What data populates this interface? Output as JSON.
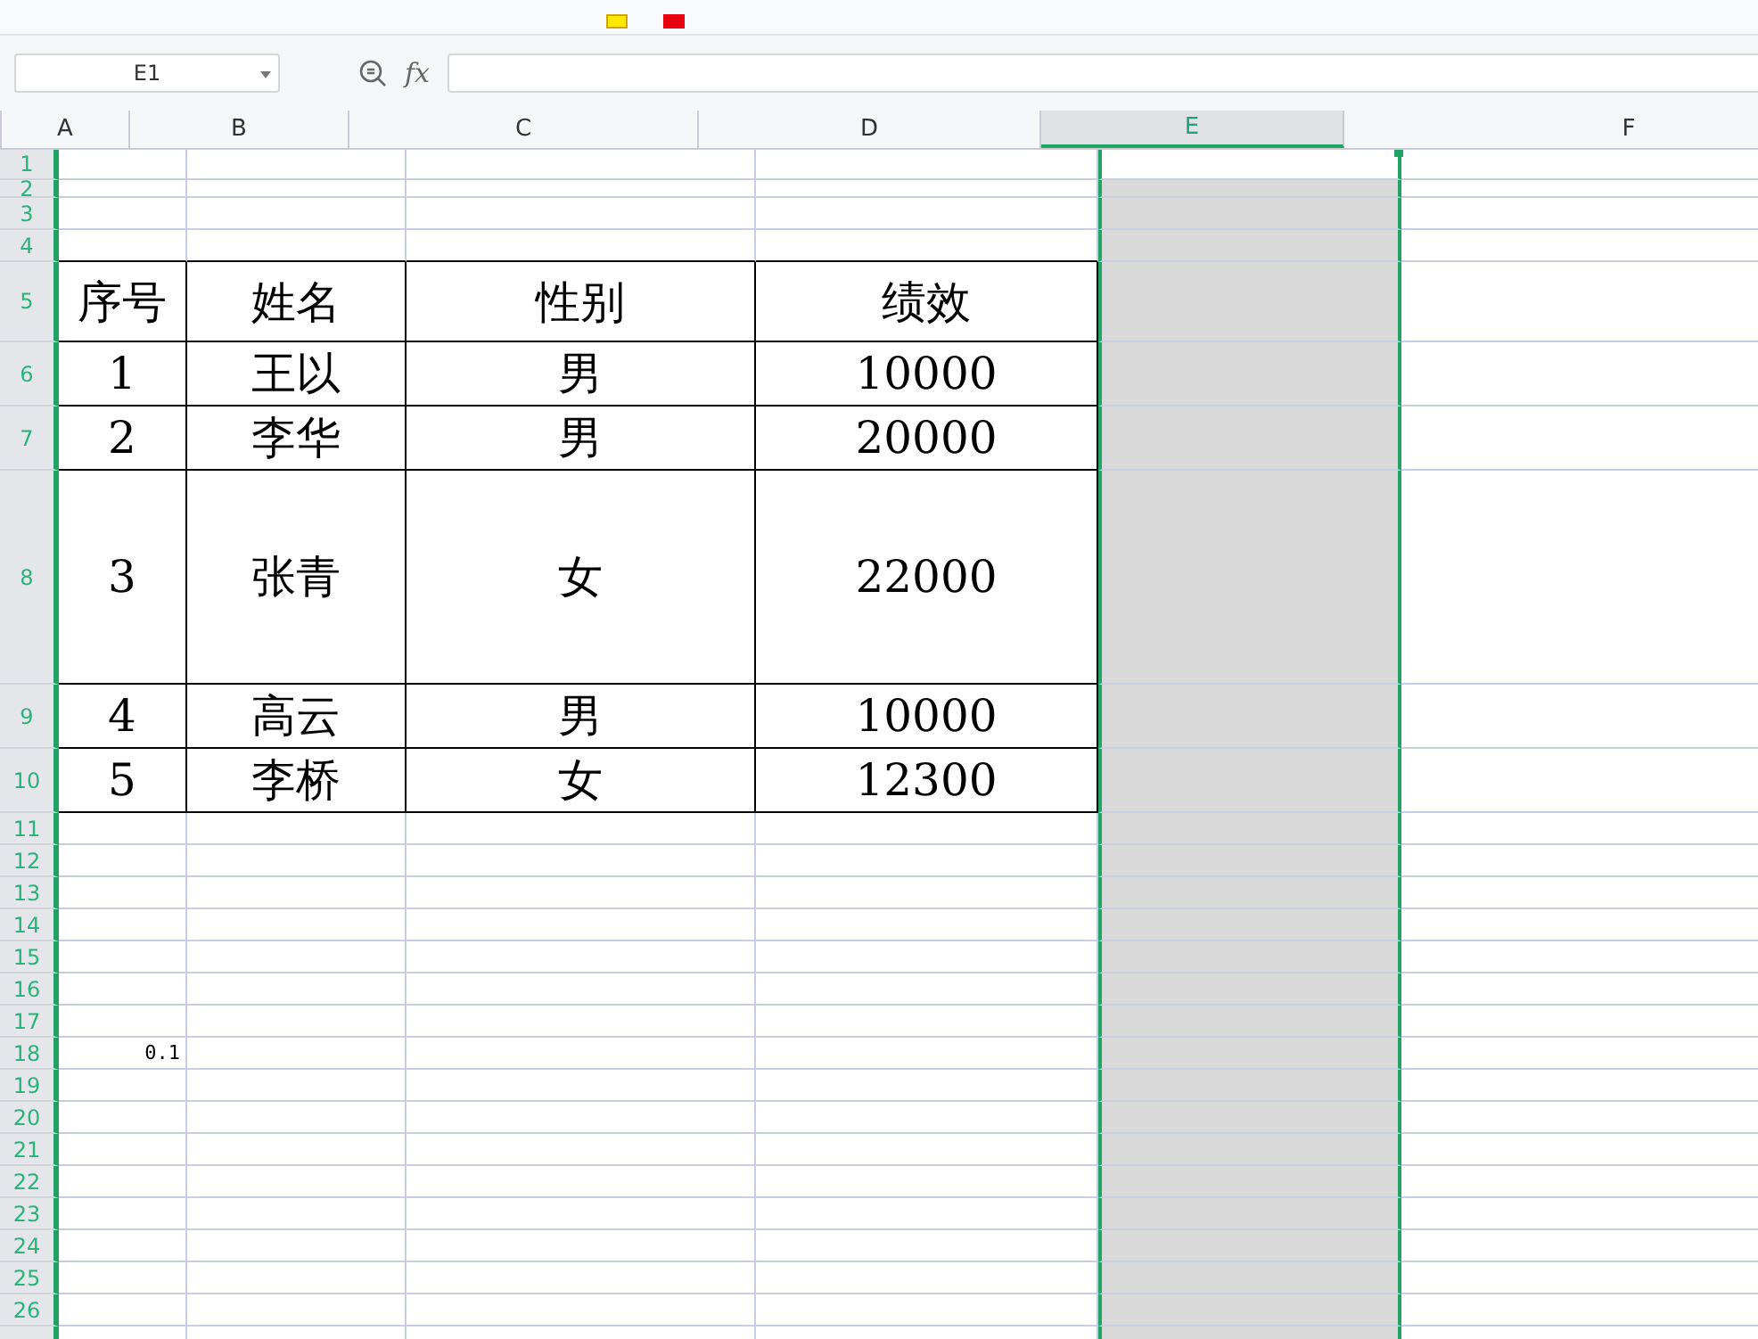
{
  "name_box": {
    "value": "E1"
  },
  "formula_bar": {
    "label": "fx"
  },
  "columns": [
    {
      "label": "A",
      "selected": false
    },
    {
      "label": "B",
      "selected": false
    },
    {
      "label": "C",
      "selected": false
    },
    {
      "label": "D",
      "selected": false
    },
    {
      "label": "E",
      "selected": true
    },
    {
      "label": "F",
      "selected": false
    }
  ],
  "rows": [
    {
      "label": "1",
      "kind": "plain"
    },
    {
      "label": "2",
      "kind": "plain"
    },
    {
      "label": "3",
      "kind": "plain"
    },
    {
      "label": "4",
      "kind": "plain"
    },
    {
      "label": "5",
      "kind": "table",
      "cells": [
        "序号",
        "姓名",
        "性别",
        "绩效"
      ]
    },
    {
      "label": "6",
      "kind": "table",
      "cells": [
        "1",
        "王以",
        "男",
        "10000"
      ]
    },
    {
      "label": "7",
      "kind": "table",
      "cells": [
        "2",
        "李华",
        "男",
        "20000"
      ]
    },
    {
      "label": "8",
      "kind": "table",
      "cells": [
        "3",
        "张青",
        "女",
        "22000"
      ]
    },
    {
      "label": "9",
      "kind": "table",
      "cells": [
        "4",
        "高云",
        "男",
        "10000"
      ]
    },
    {
      "label": "10",
      "kind": "table",
      "cells": [
        "5",
        "李桥",
        "女",
        "12300"
      ]
    },
    {
      "label": "11",
      "kind": "plain"
    },
    {
      "label": "12",
      "kind": "plain"
    },
    {
      "label": "13",
      "kind": "plain"
    },
    {
      "label": "14",
      "kind": "plain"
    },
    {
      "label": "15",
      "kind": "plain"
    },
    {
      "label": "16",
      "kind": "plain"
    },
    {
      "label": "17",
      "kind": "plain"
    },
    {
      "label": "18",
      "kind": "plain",
      "cells": [
        "0.1"
      ]
    },
    {
      "label": "19",
      "kind": "plain"
    },
    {
      "label": "20",
      "kind": "plain"
    },
    {
      "label": "21",
      "kind": "plain"
    },
    {
      "label": "22",
      "kind": "plain"
    },
    {
      "label": "23",
      "kind": "plain"
    },
    {
      "label": "24",
      "kind": "plain"
    },
    {
      "label": "25",
      "kind": "plain"
    },
    {
      "label": "26",
      "kind": "plain"
    }
  ]
}
